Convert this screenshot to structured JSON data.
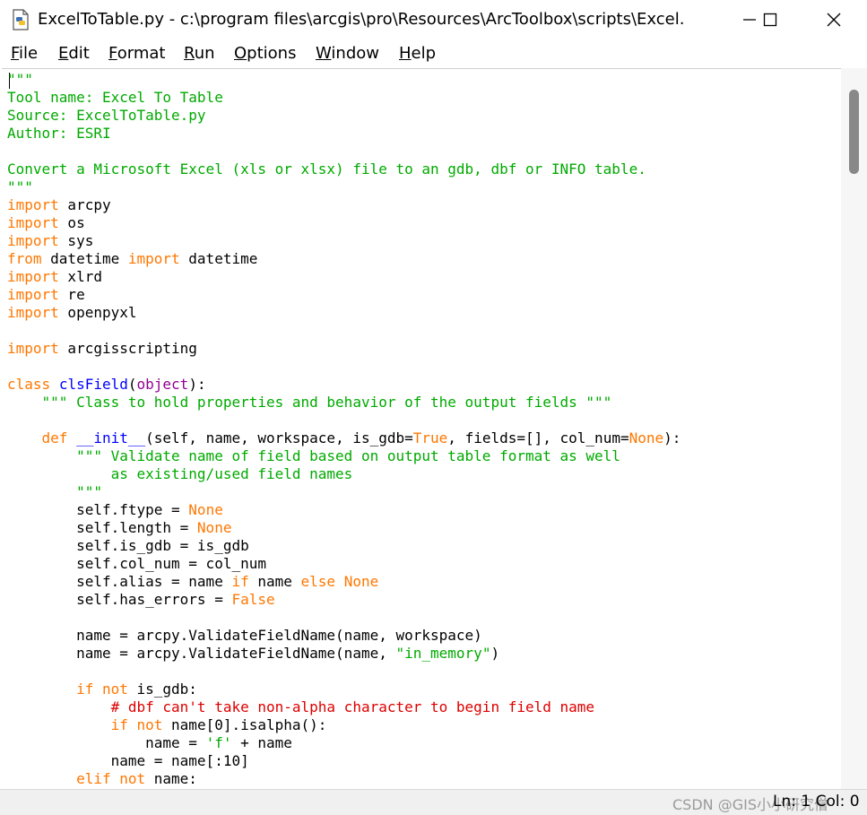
{
  "window": {
    "title": "ExcelToTable.py - c:\\program files\\arcgis\\pro\\Resources\\ArcToolbox\\scripts\\Excel...",
    "icon": "python-file-icon",
    "controls": [
      "minimize-icon",
      "maximize-icon",
      "close-icon"
    ]
  },
  "menu": {
    "items": [
      {
        "label": "File",
        "accel": "F",
        "rest": "ile"
      },
      {
        "label": "Edit",
        "accel": "E",
        "rest": "dit"
      },
      {
        "label": "Format",
        "accel": "F",
        "rest": "ormat"
      },
      {
        "label": "Run",
        "accel": "R",
        "rest": "un"
      },
      {
        "label": "Options",
        "accel": "O",
        "rest": "ptions"
      },
      {
        "label": "Window",
        "accel": "W",
        "rest": "indow"
      },
      {
        "label": "Help",
        "accel": "H",
        "rest": "elp"
      }
    ]
  },
  "colors": {
    "string": "#00aa00",
    "keyword": "#ff7700",
    "definition": "#0000ff",
    "builtin": "#900090",
    "comment": "#dd0000",
    "default": "#000000"
  },
  "editor": {
    "lines": [
      [
        {
          "t": "\"\"\"",
          "c": "str"
        }
      ],
      [
        {
          "t": "Tool name: Excel To Table",
          "c": "str"
        }
      ],
      [
        {
          "t": "Source: ExcelToTable.py",
          "c": "str"
        }
      ],
      [
        {
          "t": "Author: ESRI",
          "c": "str"
        }
      ],
      [],
      [
        {
          "t": "Convert a Microsoft Excel (xls or xlsx) file to an gdb, dbf or INFO table.",
          "c": "str"
        }
      ],
      [
        {
          "t": "\"\"\"",
          "c": "str"
        }
      ],
      [
        {
          "t": "import",
          "c": "kw"
        },
        {
          "t": " arcpy"
        }
      ],
      [
        {
          "t": "import",
          "c": "kw"
        },
        {
          "t": " os"
        }
      ],
      [
        {
          "t": "import",
          "c": "kw"
        },
        {
          "t": " sys"
        }
      ],
      [
        {
          "t": "from",
          "c": "kw"
        },
        {
          "t": " datetime "
        },
        {
          "t": "import",
          "c": "kw"
        },
        {
          "t": " datetime"
        }
      ],
      [
        {
          "t": "import",
          "c": "kw"
        },
        {
          "t": " xlrd"
        }
      ],
      [
        {
          "t": "import",
          "c": "kw"
        },
        {
          "t": " re"
        }
      ],
      [
        {
          "t": "import",
          "c": "kw"
        },
        {
          "t": " openpyxl"
        }
      ],
      [],
      [
        {
          "t": "import",
          "c": "kw"
        },
        {
          "t": " arcgisscripting"
        }
      ],
      [],
      [
        {
          "t": "class",
          "c": "kw"
        },
        {
          "t": " "
        },
        {
          "t": "clsField",
          "c": "def"
        },
        {
          "t": "("
        },
        {
          "t": "object",
          "c": "builtin"
        },
        {
          "t": "):"
        }
      ],
      [
        {
          "t": "    "
        },
        {
          "t": "\"\"\" Class to hold properties and behavior of the output fields \"\"\"",
          "c": "str"
        }
      ],
      [],
      [
        {
          "t": "    "
        },
        {
          "t": "def",
          "c": "kw"
        },
        {
          "t": " "
        },
        {
          "t": "__init__",
          "c": "def"
        },
        {
          "t": "(self, name, workspace, is_gdb="
        },
        {
          "t": "True",
          "c": "kw"
        },
        {
          "t": ", fields=[], col_num="
        },
        {
          "t": "None",
          "c": "kw"
        },
        {
          "t": "):"
        }
      ],
      [
        {
          "t": "        "
        },
        {
          "t": "\"\"\" Validate name of field based on output table format as well",
          "c": "str"
        }
      ],
      [
        {
          "t": "            as existing/used field names",
          "c": "str"
        }
      ],
      [
        {
          "t": "        "
        },
        {
          "t": "\"\"\"",
          "c": "str"
        }
      ],
      [
        {
          "t": "        self.ftype = "
        },
        {
          "t": "None",
          "c": "kw"
        }
      ],
      [
        {
          "t": "        self.length = "
        },
        {
          "t": "None",
          "c": "kw"
        }
      ],
      [
        {
          "t": "        self.is_gdb = is_gdb"
        }
      ],
      [
        {
          "t": "        self.col_num = col_num"
        }
      ],
      [
        {
          "t": "        self.alias = name "
        },
        {
          "t": "if",
          "c": "kw"
        },
        {
          "t": " name "
        },
        {
          "t": "else",
          "c": "kw"
        },
        {
          "t": " "
        },
        {
          "t": "None",
          "c": "kw"
        }
      ],
      [
        {
          "t": "        self.has_errors = "
        },
        {
          "t": "False",
          "c": "kw"
        }
      ],
      [],
      [
        {
          "t": "        name = arcpy.ValidateFieldName(name, workspace)"
        }
      ],
      [
        {
          "t": "        name = arcpy.ValidateFieldName(name, "
        },
        {
          "t": "\"in_memory\"",
          "c": "str"
        },
        {
          "t": ")"
        }
      ],
      [],
      [
        {
          "t": "        "
        },
        {
          "t": "if",
          "c": "kw"
        },
        {
          "t": " "
        },
        {
          "t": "not",
          "c": "kw"
        },
        {
          "t": " is_gdb:"
        }
      ],
      [
        {
          "t": "            "
        },
        {
          "t": "# dbf can't take non-alpha character to begin field name",
          "c": "comment"
        }
      ],
      [
        {
          "t": "            "
        },
        {
          "t": "if",
          "c": "kw"
        },
        {
          "t": " "
        },
        {
          "t": "not",
          "c": "kw"
        },
        {
          "t": " name[0].isalpha():"
        }
      ],
      [
        {
          "t": "                name = "
        },
        {
          "t": "'f'",
          "c": "str"
        },
        {
          "t": " + name"
        }
      ],
      [
        {
          "t": "            name = name[:10]"
        }
      ],
      [
        {
          "t": "        "
        },
        {
          "t": "elif",
          "c": "kw"
        },
        {
          "t": " "
        },
        {
          "t": "not",
          "c": "kw"
        },
        {
          "t": " name:"
        }
      ]
    ]
  },
  "status": {
    "watermark": "CSDN @GIS小小研究僧",
    "position": "Ln: 1 Col: 0"
  }
}
